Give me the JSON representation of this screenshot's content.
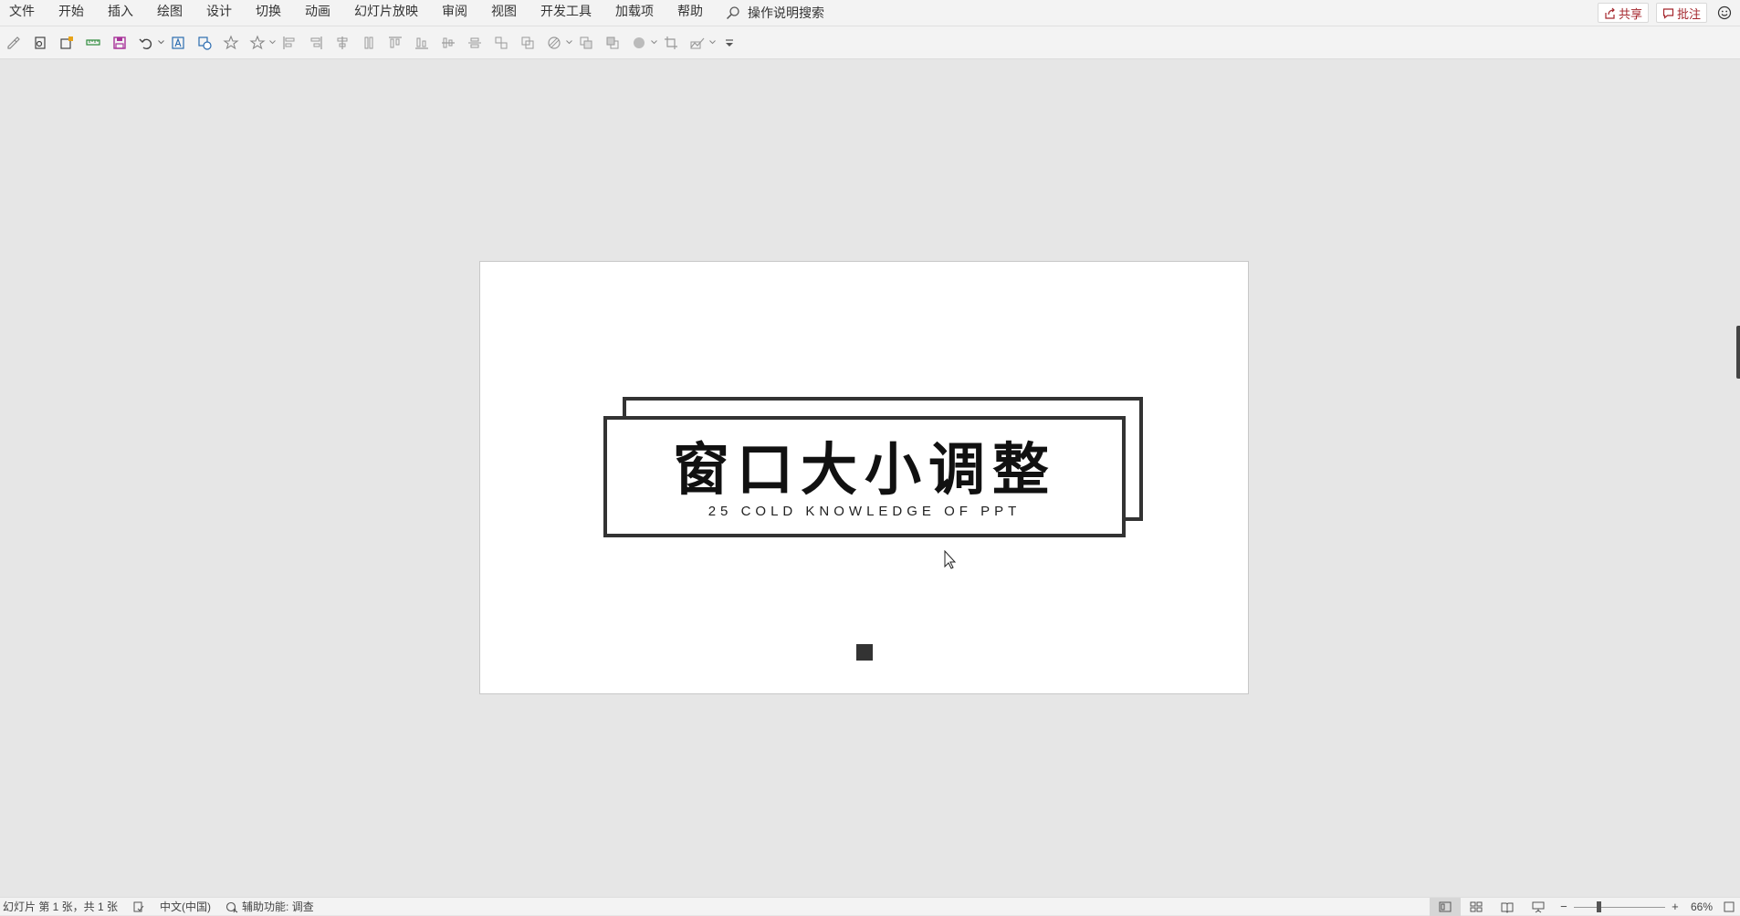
{
  "menu": {
    "items": [
      "文件",
      "开始",
      "插入",
      "绘图",
      "设计",
      "切换",
      "动画",
      "幻灯片放映",
      "审阅",
      "视图",
      "开发工具",
      "加载项",
      "帮助"
    ],
    "search_label": "操作说明搜索"
  },
  "actions": {
    "share_label": "共享",
    "comment_label": "批注"
  },
  "quick_access": {
    "tools": [
      "format-painter",
      "open-file",
      "image-edit",
      "ruler-tool",
      "save",
      "undo",
      "text-box",
      "shapes",
      "star",
      "star-outline",
      "align-left",
      "align-right",
      "align-center",
      "align-top",
      "distribute-v",
      "align-middle",
      "align-bottom",
      "distribute-h",
      "stack",
      "group",
      "ungroup",
      "shape-fill",
      "bring-forward",
      "send-backward",
      "circle-fill",
      "crop",
      "freeform",
      "customize"
    ]
  },
  "slide": {
    "title": "窗口大小调整",
    "subtitle": "25 COLD KNOWLEDGE OF PPT"
  },
  "status": {
    "slide_info": "幻灯片 第 1 张，共 1 张",
    "language": "中文(中国)",
    "accessibility": "辅助功能: 调查",
    "zoom_label": "66%",
    "zoom_fraction": 0.28
  },
  "colors": {
    "accent_red": "#a4262c",
    "frame": "#333333",
    "canvas": "#e6e6e6"
  }
}
